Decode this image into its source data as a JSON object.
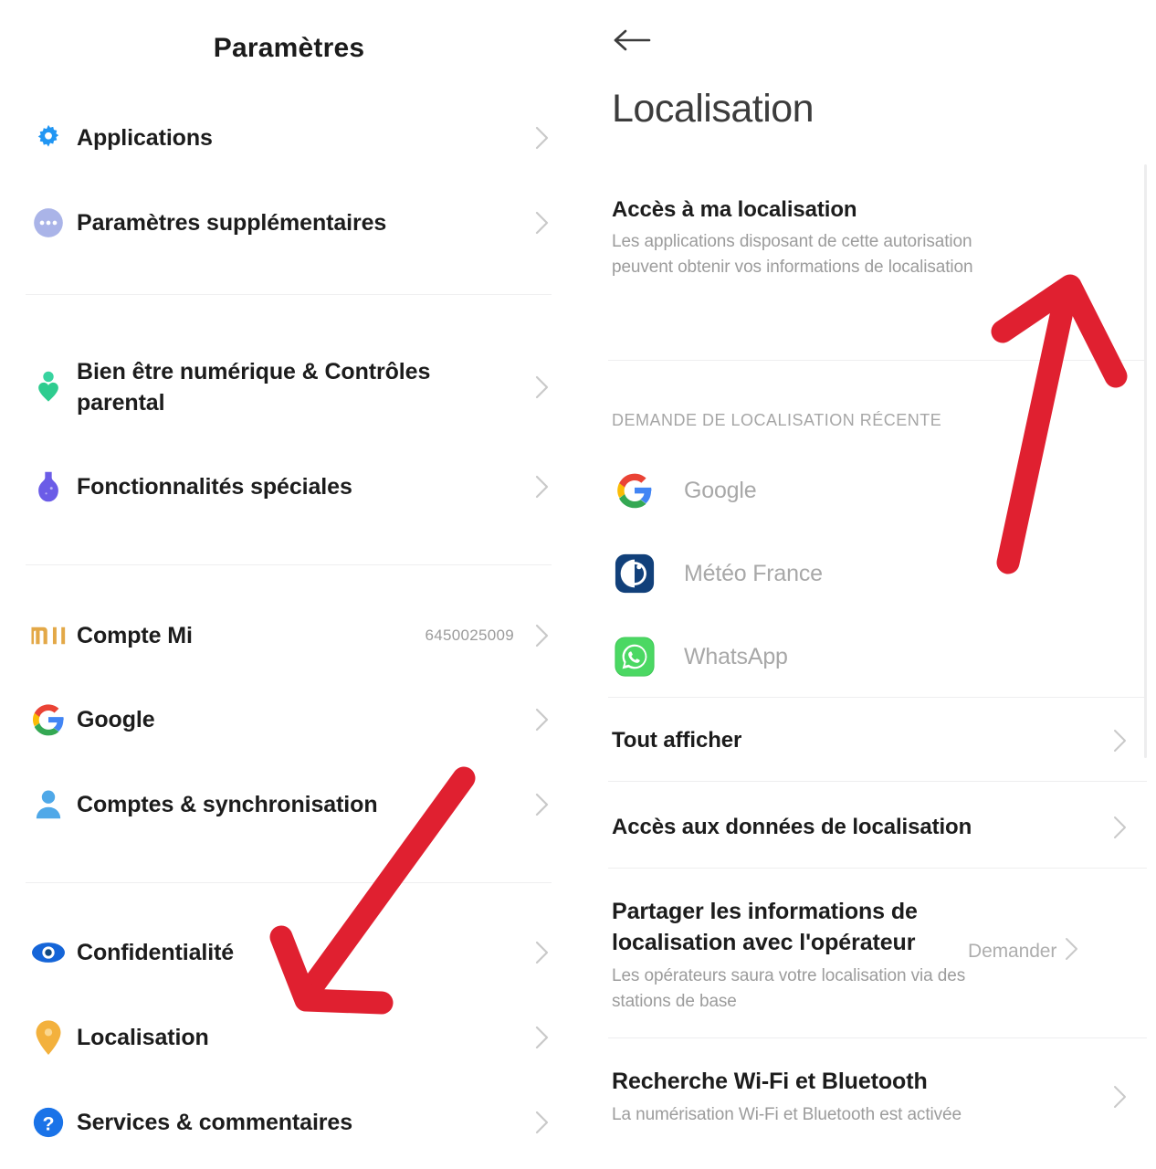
{
  "left": {
    "title": "Paramètres",
    "items": [
      {
        "label": "Applications",
        "icon": "gear-icon",
        "value": "",
        "color": "#2196f3"
      },
      {
        "label": "Paramètres supplémentaires",
        "icon": "more-horizontal-icon",
        "value": "",
        "color": "#aab4e8"
      },
      {
        "label": "Bien être numérique & Contrôles parental",
        "icon": "wellbeing-icon",
        "value": "",
        "color": "#2ecc8f"
      },
      {
        "label": "Fonctionnalités spéciales",
        "icon": "special-features-icon",
        "value": "",
        "color": "#6b5ce7"
      },
      {
        "label": "Compte Mi",
        "icon": "mi-logo-icon",
        "value": "6450025009",
        "color": "#e8ab4d"
      },
      {
        "label": "Google",
        "icon": "google-logo-icon",
        "value": "",
        "color": "#4285f4"
      },
      {
        "label": "Comptes & synchronisation",
        "icon": "account-person-icon",
        "value": "",
        "color": "#4fa8e8"
      },
      {
        "label": "Confidentialité",
        "icon": "eye-icon",
        "value": "",
        "color": "#1565d8"
      },
      {
        "label": "Localisation",
        "icon": "location-pin-icon",
        "value": "",
        "color": "#f3b13d"
      },
      {
        "label": "Services & commentaires",
        "icon": "help-question-icon",
        "value": "",
        "color": "#1a73e8"
      }
    ]
  },
  "right": {
    "back_icon": "back-arrow-icon",
    "title": "Localisation",
    "access": {
      "title": "Accès à ma localisation",
      "description": "Les applications disposant de cette autorisation peuvent obtenir vos informations de localisation",
      "toggle_state": "off"
    },
    "recent_section_label": "DEMANDE DE LOCALISATION RÉCENTE",
    "recent_apps": [
      {
        "name": "Google",
        "icon": "google-logo-icon"
      },
      {
        "name": "Météo France",
        "icon": "meteo-france-icon"
      },
      {
        "name": "WhatsApp",
        "icon": "whatsapp-icon"
      }
    ],
    "show_all": "Tout afficher",
    "data_access": "Accès aux données de localisation",
    "carrier": {
      "title": "Partager les informations de localisation avec l'opérateur",
      "value": "Demander",
      "description": "Les opérateurs saura votre localisation via des stations de base"
    },
    "wifi_bt": {
      "title": "Recherche Wi-Fi et Bluetooth",
      "description": "La numérisation Wi-Fi et Bluetooth est activée"
    }
  },
  "annotations": {
    "arrow_color": "#e02030",
    "left_arrow_name": "red-arrow-pointing-to-localisation",
    "right_arrow_name": "red-arrow-pointing-to-toggle"
  }
}
